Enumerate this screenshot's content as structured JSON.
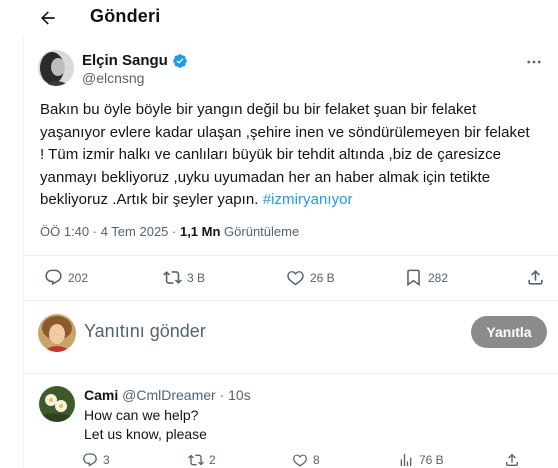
{
  "header": {
    "title": "Gönderi",
    "back_icon": "arrow-left-icon"
  },
  "tweet": {
    "author": {
      "name": "Elçin Sangu",
      "handle": "@elcnsng",
      "verified": true,
      "verified_color": "#1d9bf0"
    },
    "text_lines": [
      "Bakın bu öyle böyle bir yangın değil bu bir felaket şuan bir felaket",
      "yaşanıyor evlere kadar ulaşan ,şehire inen ve söndürülemeyen bir felaket",
      "! Tüm izmir halkı  ve canlıları büyük bir tehdit altında ,biz de çaresizce",
      "yanmayı bekliyoruz ,uyku uyumadan her an haber almak için tetikte",
      "bekliyoruz .Artık bir şeyler yapın. "
    ],
    "hashtag": "#izmiryanıyor",
    "hashtag_color": "#1d9bf0",
    "time": "ÖÖ 1:40",
    "separator": " · ",
    "date": "4 Tem 2025",
    "views_count": "1,1 Mn",
    "views_label": " Görüntüleme",
    "actions": {
      "replies": "202",
      "retweets": "3 B",
      "likes": "26 B",
      "bookmarks": "282"
    }
  },
  "reply_box": {
    "placeholder": "Yanıtını gönder",
    "button_label": "Yanıtla",
    "button_color": "#8b8b8b"
  },
  "comment": {
    "name": "Cami",
    "handle": "@CmlDreamer",
    "dot": "·",
    "time": "10s",
    "lines": [
      "How can we help?",
      "Let us know, please"
    ],
    "actions": {
      "replies": "3",
      "retweets": "2",
      "likes": "8",
      "views": "76 B"
    }
  }
}
